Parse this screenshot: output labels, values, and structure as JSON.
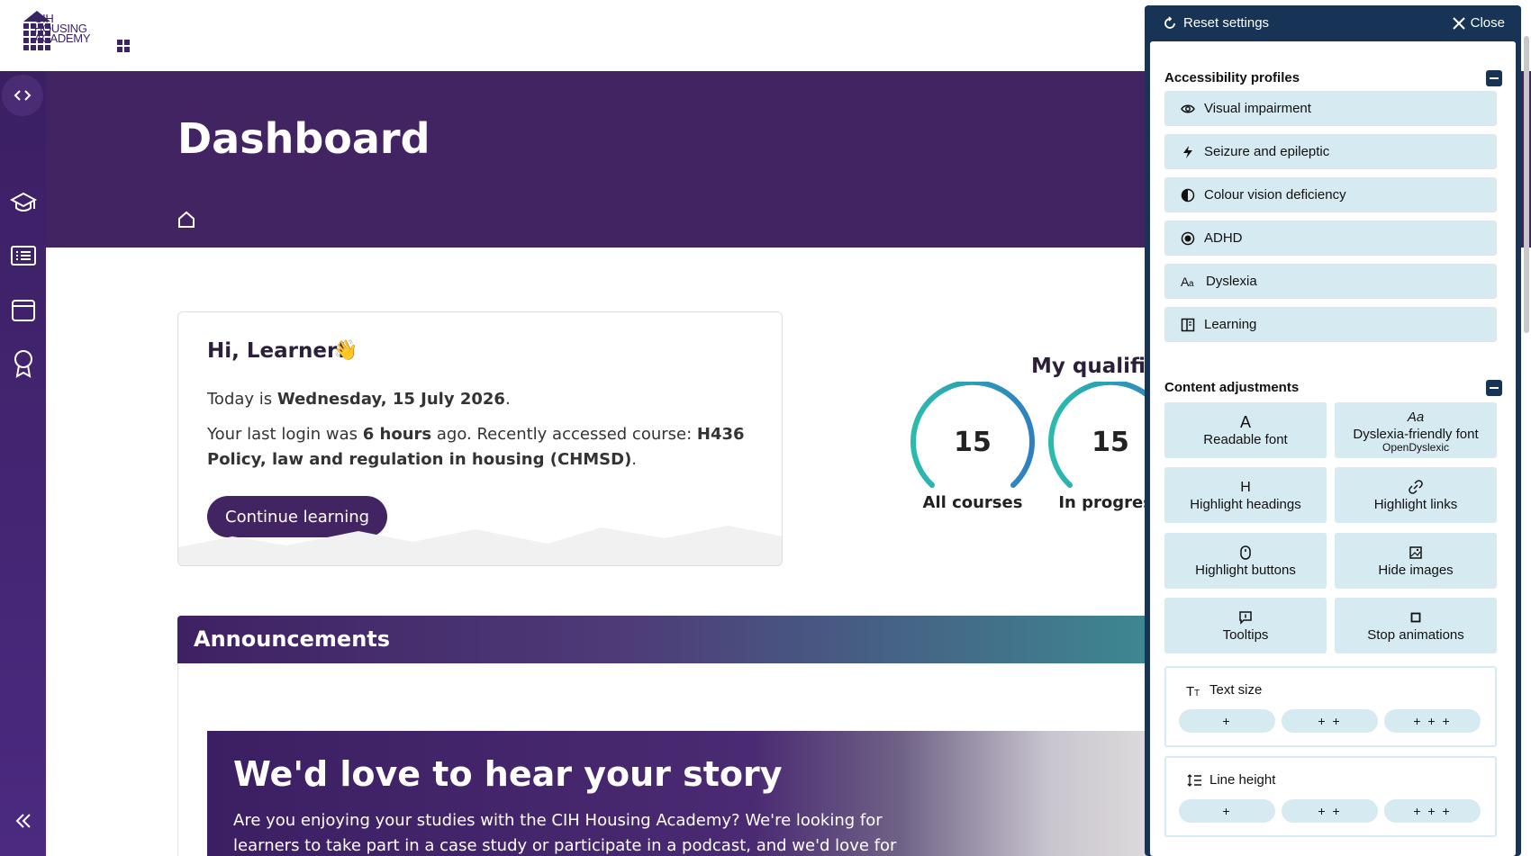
{
  "brand": {
    "logo_text_1": "CIH",
    "logo_text_2": "HOUSING",
    "logo_text_3": "ACADEMY"
  },
  "header": {
    "title": "Dashboard"
  },
  "welcome": {
    "greeting": "Hi, Learner!",
    "today_prefix": "Today is ",
    "today_date": "Wednesday, 15 July 2026",
    "today_suffix": ".",
    "login_prefix": "Your last login was ",
    "login_time": "6 hours",
    "login_mid": " ago. Recently accessed course: ",
    "course": "H436 Policy, law and regulation in housing (CHMSD)",
    "login_suffix": ".",
    "button": "Continue learning"
  },
  "qualifications": {
    "title": "My qualifications",
    "gauges": [
      {
        "value": "15",
        "label": "All courses"
      },
      {
        "value": "15",
        "label": "In progress"
      }
    ]
  },
  "announcements": {
    "title": "Announcements",
    "story_title": "We'd love to hear your story",
    "story_text": "Are you enjoying your studies with the CIH Housing Academy? We're looking for learners to take part in a case study or participate in a podcast, and we'd love for you"
  },
  "accessibility": {
    "reset": "Reset settings",
    "close": "Close",
    "profiles_title": "Accessibility profiles",
    "profiles": [
      {
        "label": "Visual impairment",
        "icon": "eye-icon"
      },
      {
        "label": "Seizure and epileptic",
        "icon": "bolt-icon"
      },
      {
        "label": "Colour vision deficiency",
        "icon": "contrast-icon"
      },
      {
        "label": "ADHD",
        "icon": "target-icon"
      },
      {
        "label": "Dyslexia",
        "icon": "font-icon"
      },
      {
        "label": "Learning",
        "icon": "book-icon"
      }
    ],
    "content_title": "Content adjustments",
    "tiles": [
      {
        "label": "Readable font",
        "sub": ""
      },
      {
        "label": "Dyslexia-friendly font",
        "sub": "OpenDyslexic"
      },
      {
        "label": "Highlight headings",
        "sub": ""
      },
      {
        "label": "Highlight links",
        "sub": ""
      },
      {
        "label": "Highlight buttons",
        "sub": ""
      },
      {
        "label": "Hide images",
        "sub": ""
      },
      {
        "label": "Tooltips",
        "sub": ""
      },
      {
        "label": "Stop animations",
        "sub": ""
      }
    ],
    "tile_glyphs": {
      "readable": "A",
      "dyslexia": "Aa",
      "headings": "H"
    },
    "text_size": {
      "label": "Text size",
      "options": [
        "+",
        "+ +",
        "+ + +"
      ]
    },
    "line_height": {
      "label": "Line height",
      "options": [
        "+",
        "+ +",
        "+ + +"
      ]
    }
  },
  "colors": {
    "brand_purple": "#432463",
    "panel_navy": "#173456",
    "tile_bg": "#d6eaf1",
    "gauge_teal": "#2bbbad",
    "gauge_blue": "#2f7fc1"
  }
}
